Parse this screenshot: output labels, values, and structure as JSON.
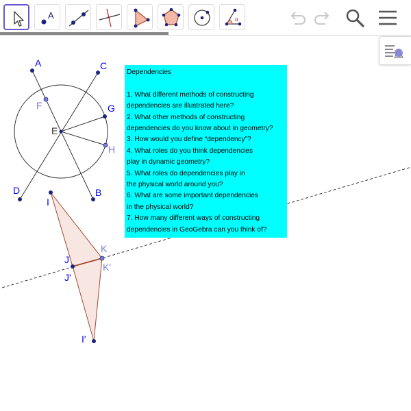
{
  "toolbar": {
    "tools": [
      {
        "name": "move-tool",
        "selected": true
      },
      {
        "name": "point-tool",
        "icon_letter": "A"
      },
      {
        "name": "line-tool"
      },
      {
        "name": "perpendicular-line-tool"
      },
      {
        "name": "polygon-tool"
      },
      {
        "name": "regular-polygon-tool"
      },
      {
        "name": "circle-tool"
      },
      {
        "name": "angle-tool",
        "icon_letter": "α"
      }
    ],
    "actions": [
      "undo-icon",
      "redo-icon",
      "search-icon",
      "menu-icon"
    ]
  },
  "colors": {
    "accent": "#6557d2",
    "point_dark": "#1a237e",
    "point_light": "#7b7fd6",
    "label_blue": "#0000ff",
    "label_light": "#7b7fd6",
    "polygon_fill": "#f7e6e2",
    "polygon_edge": "#9e4a2a",
    "info_box": "#00ffff"
  },
  "info_box": {
    "title": "Dependencies",
    "lines": [
      "1. What different methods of constructing",
      "dependencies are illustrated here?",
      "2. What other methods of constructing",
      "dependencies do you know about in geometry?",
      "3. How would you define “dependency”?",
      "4. What roles do you think dependencies",
      "play in dynamic geometry?",
      "5. What roles do dependencies play in",
      "the physical world around you?",
      "6. What are some important dependencies",
      "in the physical world?",
      "7. How many different ways of constructing",
      "dependencies in GeoGebra can you think of?"
    ]
  },
  "points": {
    "A": "A",
    "B": "B",
    "C": "C",
    "D": "D",
    "E": "E",
    "F": "F",
    "G": "G",
    "H": "H",
    "I": "I",
    "J": "J",
    "K": "K",
    "I_prime": "I'",
    "J_prime": "J'",
    "K_prime": "K'"
  }
}
